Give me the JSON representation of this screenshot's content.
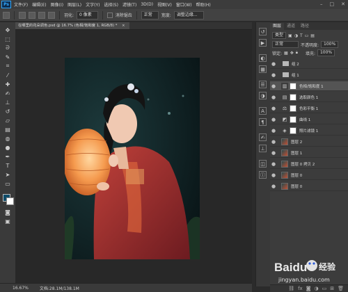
{
  "app": {
    "logo": "Ps"
  },
  "menu": [
    "文件(F)",
    "编辑(E)",
    "图像(I)",
    "图层(L)",
    "文字(Y)",
    "选择(S)",
    "滤镜(T)",
    "3D(D)",
    "视图(V)",
    "窗口(W)",
    "帮助(H)"
  ],
  "window_controls": [
    "–",
    "□",
    "✕"
  ],
  "options_bar": {
    "feather_label": "羽化:",
    "feather_value": "0 像素",
    "mode_value": "正常",
    "antialias_label": "消除锯齿",
    "width_label": "宽度:",
    "refine_label": "调整边缘..."
  },
  "document_tab": {
    "title": "在哪里的花朵调色.psd @ 16.7% (色相/饱和度 1, RGB/8) *",
    "close": "×"
  },
  "panel": {
    "tabs": [
      "图层",
      "通道",
      "路径"
    ],
    "kind_label": "类型",
    "blend_mode": "正常",
    "opacity_label": "不透明度:",
    "opacity_value": "100%",
    "lock_label": "锁定:",
    "fill_label": "填充:",
    "fill_value": "100%"
  },
  "layers": [
    {
      "name": "组 2",
      "type": "group"
    },
    {
      "name": "组 1",
      "type": "group"
    },
    {
      "name": "色相/饱和度 1",
      "type": "adjust",
      "icon": "▥"
    },
    {
      "name": "选取颜色 1",
      "type": "adjust",
      "icon": "▤"
    },
    {
      "name": "色彩平衡 1",
      "type": "adjust",
      "icon": "⚖"
    },
    {
      "name": "曲线 1",
      "type": "adjust",
      "icon": "◩"
    },
    {
      "name": "照片滤镜 1",
      "type": "adjust",
      "icon": "◈"
    },
    {
      "name": "图层 2",
      "type": "pixel"
    },
    {
      "name": "图层 1",
      "type": "pixel"
    },
    {
      "name": "图层 0 拷贝 2",
      "type": "pixel"
    },
    {
      "name": "图层 0",
      "type": "pixel"
    },
    {
      "name": "图层 0",
      "type": "pixel"
    }
  ],
  "status": {
    "zoom": "16.67%",
    "doc": "文档:28.1M/138.1M"
  },
  "watermark": {
    "brand": "Baidu",
    "suffix": "经验",
    "url": "jingyan.baidu.com"
  },
  "colors": {
    "foreground": "#0e4b68",
    "background": "#ffffff",
    "accent": "#31a8ff"
  }
}
